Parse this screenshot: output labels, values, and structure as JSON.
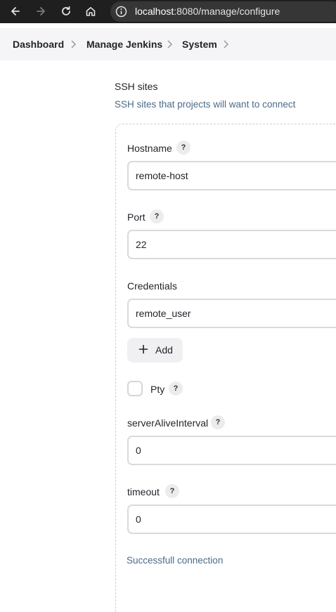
{
  "browser": {
    "url_host": "localhost",
    "url_rest": ":8080/manage/configure"
  },
  "breadcrumb": {
    "items": [
      "Dashboard",
      "Manage Jenkins",
      "System"
    ]
  },
  "section": {
    "title": "SSH sites",
    "description": "SSH sites that projects will want to connect"
  },
  "form": {
    "hostname": {
      "label": "Hostname",
      "help": "?",
      "value": "remote-host"
    },
    "port": {
      "label": "Port",
      "help": "?",
      "value": "22"
    },
    "credentials": {
      "label": "Credentials",
      "value": "remote_user"
    },
    "add_button": {
      "label": "Add"
    },
    "pty": {
      "label": "Pty",
      "help": "?",
      "checked": false
    },
    "server_alive_interval": {
      "label": "serverAliveInterval",
      "help": "?",
      "value": "0"
    },
    "timeout": {
      "label": "timeout",
      "help": "?",
      "value": "0"
    },
    "status_text": "Successfull connection"
  },
  "colors": {
    "chrome_bg": "#1f1f1f",
    "breadcrumb_bg": "#f5f5f7",
    "link_blue": "#4c6b8a"
  },
  "icons": {
    "back": "back-arrow-icon",
    "forward": "forward-arrow-icon",
    "reload": "reload-icon",
    "home": "home-icon",
    "site_info": "info-icon",
    "breadcrumb_separator": "chevron-right-icon",
    "add": "plus-icon"
  }
}
